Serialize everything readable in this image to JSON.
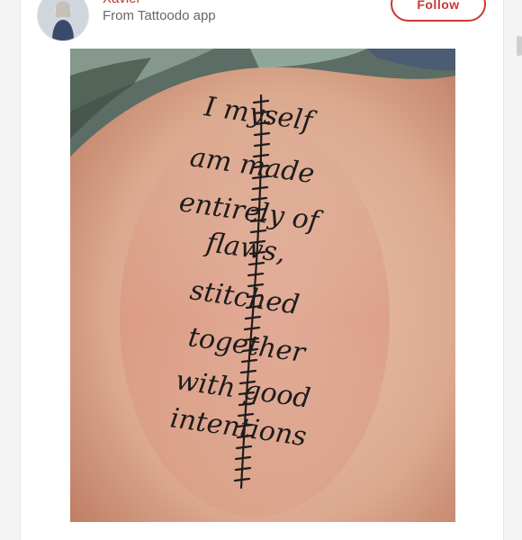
{
  "post": {
    "author": "Xavier",
    "source": "From Tattoodo app",
    "follow_label": "Follow"
  },
  "tattoo": {
    "lines": [
      "I myself",
      "am made",
      "entirely of",
      "flaws,",
      "stitched",
      "together",
      "with good",
      "intentions"
    ]
  },
  "icons": {
    "avatar": "avatar-photo"
  },
  "colors": {
    "accent": "#c63a33",
    "author": "#c0352b",
    "skin": "#d9a98f",
    "ink": "#1e1c1c"
  }
}
